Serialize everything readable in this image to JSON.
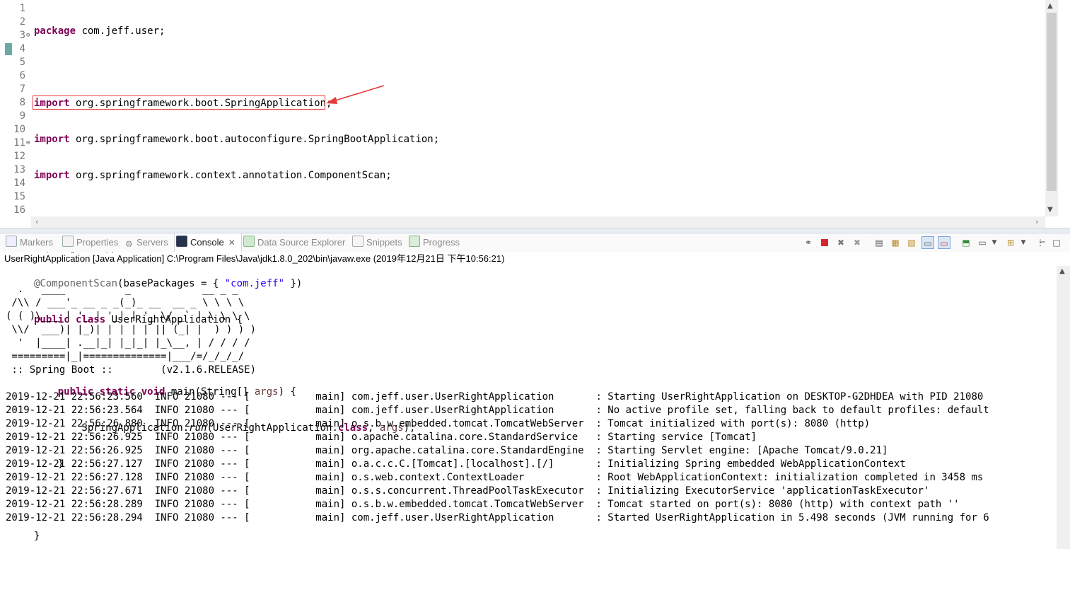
{
  "editor": {
    "line_numbers": [
      "1",
      "2",
      "3",
      "4",
      "5",
      "6",
      "7",
      "8",
      "9",
      "10",
      "11",
      "12",
      "13",
      "14",
      "15",
      "16"
    ]
  },
  "bottom_tabs": [
    {
      "label": "Markers"
    },
    {
      "label": "Properties"
    },
    {
      "label": "Servers"
    },
    {
      "label": "Console"
    },
    {
      "label": "Data Source Explorer"
    },
    {
      "label": "Snippets"
    },
    {
      "label": "Progress"
    }
  ],
  "console": {
    "description": "UserRightApplication [Java Application] C:\\Program Files\\Java\\jdk1.8.0_202\\bin\\javaw.exe (2019年12月21日 下午10:56:21)",
    "banner": [
      "  .   ____          _            __ _ _",
      " /\\\\ / ___'_ __ _ _(_)_ __  __ _ \\ \\ \\ \\",
      "( ( )\\___ | '_ | '_| | '_ \\/ _` | \\ \\ \\ \\",
      " \\\\/  ___)| |_)| | | | | || (_| |  ) ) ) )",
      "  '  |____| .__|_| |_|_| |_\\__, | / / / /",
      " =========|_|==============|___/=/_/_/_/",
      " :: Spring Boot ::        (v2.1.6.RELEASE)"
    ],
    "log_lines": [
      "2019-12-21 22:56:23.560  INFO 21080 --- [           main] com.jeff.user.UserRightApplication       : Starting UserRightApplication on DESKTOP-G2DHDEA with PID 21080",
      "2019-12-21 22:56:23.564  INFO 21080 --- [           main] com.jeff.user.UserRightApplication       : No active profile set, falling back to default profiles: default",
      "2019-12-21 22:56:26.880  INFO 21080 --- [           main] o.s.b.w.embedded.tomcat.TomcatWebServer  : Tomcat initialized with port(s): 8080 (http)",
      "2019-12-21 22:56:26.925  INFO 21080 --- [           main] o.apache.catalina.core.StandardService   : Starting service [Tomcat]",
      "2019-12-21 22:56:26.925  INFO 21080 --- [           main] org.apache.catalina.core.StandardEngine  : Starting Servlet engine: [Apache Tomcat/9.0.21]",
      "2019-12-21 22:56:27.127  INFO 21080 --- [           main] o.a.c.c.C.[Tomcat].[localhost].[/]       : Initializing Spring embedded WebApplicationContext",
      "2019-12-21 22:56:27.128  INFO 21080 --- [           main] o.s.web.context.ContextLoader            : Root WebApplicationContext: initialization completed in 3458 ms",
      "2019-12-21 22:56:27.671  INFO 21080 --- [           main] o.s.s.concurrent.ThreadPoolTaskExecutor  : Initializing ExecutorService 'applicationTaskExecutor'",
      "2019-12-21 22:56:28.289  INFO 21080 --- [           main] o.s.b.w.embedded.tomcat.TomcatWebServer  : Tomcat started on port(s): 8080 (http) with context path ''",
      "2019-12-21 22:56:28.294  INFO 21080 --- [           main] com.jeff.user.UserRightApplication       : Started UserRightApplication in 5.498 seconds (JVM running for 6"
    ]
  },
  "icons": {
    "toolbar": [
      "link-icon",
      "terminate-icon",
      "remove-launch-icon",
      "remove-all-launches-icon",
      "clear-console-icon",
      "scroll-lock-icon",
      "word-wrap-icon",
      "show-on-stdout-icon",
      "show-on-stderr-icon",
      "pin-console-icon",
      "display-console-icon",
      "dropdown-icon",
      "open-console-icon",
      "dropdown-icon",
      "view-menu-icon",
      "minimize-icon",
      "maximize-icon"
    ]
  },
  "colors": {
    "keyword": "#7f0055",
    "annotation": "#646464",
    "string": "#2a00ff",
    "highlight_box": "#e83a3a"
  }
}
